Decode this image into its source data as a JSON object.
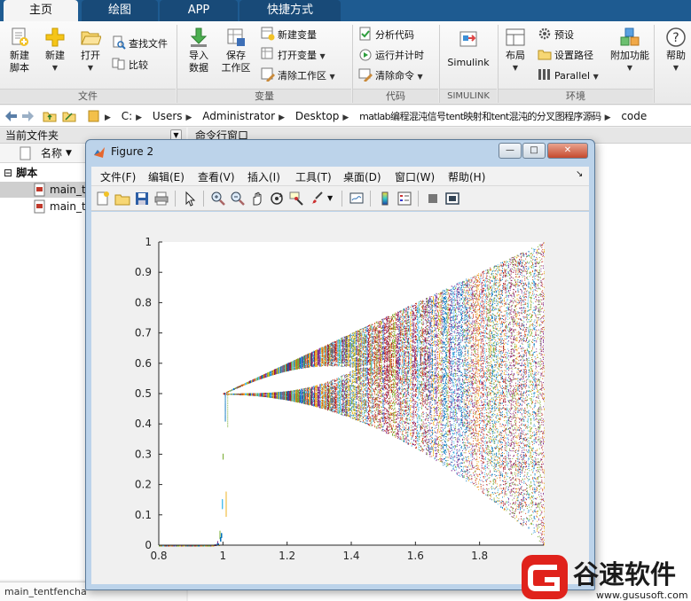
{
  "tabs": [
    {
      "label": "主页",
      "active": true
    },
    {
      "label": "绘图"
    },
    {
      "label": "APP"
    },
    {
      "label": "快捷方式"
    }
  ],
  "ribbon": {
    "file": {
      "new_script": "新建\n脚本",
      "new": "新建",
      "open": "打开",
      "find_files": "查找文件",
      "compare": "比较",
      "group": "文件"
    },
    "variable": {
      "import_data": "导入\n数据",
      "save_workspace": "保存\n工作区",
      "new_variable": "新建变量",
      "open_variable": "打开变量",
      "clear_workspace": "清除工作区",
      "group": "变量"
    },
    "code": {
      "analyze_code": "分析代码",
      "run_and_time": "运行并计时",
      "clear_commands": "清除命令",
      "group": "代码"
    },
    "simulink": {
      "label": "Simulink",
      "group": "SIMULINK"
    },
    "environment": {
      "layout": "布局",
      "preferences": "预设",
      "set_path": "设置路径",
      "parallel": "Parallel",
      "addons": "附加功能",
      "group": "环境"
    },
    "help": "帮助"
  },
  "address": {
    "crumbs": [
      "C:",
      "Users",
      "Administrator",
      "Desktop",
      "matlab编程混沌信号tent映射和tent混沌的分叉图程序源码",
      "code"
    ]
  },
  "left_panel": {
    "title": "当前文件夹",
    "col_name": "名称",
    "folder": "脚本",
    "files": [
      "main_te",
      "main_te"
    ],
    "status": "main_tentfencha"
  },
  "command_window": {
    "title": "命令行窗口"
  },
  "figure": {
    "title": "Figure 2",
    "menus": [
      "文件(F)",
      "编辑(E)",
      "查看(V)",
      "插入(I)",
      "工具(T)",
      "桌面(D)",
      "窗口(W)",
      "帮助(H)"
    ],
    "window_buttons": {
      "minimize": "—",
      "maximize": "□",
      "close": "✕"
    }
  },
  "chart_data": {
    "type": "scatter",
    "title": "",
    "xlabel": "",
    "ylabel": "",
    "xlim": [
      0.8,
      2.0
    ],
    "ylim": [
      0,
      1
    ],
    "xticks": [
      0.8,
      1,
      1.2,
      1.4,
      1.6,
      1.8
    ],
    "yticks": [
      0,
      0.1,
      0.2,
      0.3,
      0.4,
      0.5,
      0.6,
      0.7,
      0.8,
      0.9,
      1
    ],
    "grid": false,
    "series": [
      {
        "x": [
          0.85,
          0.9,
          0.95,
          0.98,
          1.0,
          1.0,
          1.0,
          1.0,
          1.05,
          1.1,
          1.2,
          1.3,
          1.35,
          1.4,
          1.42,
          1.5,
          1.6,
          1.7,
          1.8,
          1.9,
          2.0
        ],
        "y": [
          0,
          0,
          0,
          0.02,
          0.05,
          0.3,
          0.45,
          0.5,
          0.52,
          0.55,
          0.6,
          0.65,
          0.64,
          0.7,
          0.66,
          0.75,
          0.8,
          0.85,
          0.9,
          0.95,
          1.0
        ]
      }
    ],
    "palette": [
      "#0072bd",
      "#d95319",
      "#edb120",
      "#7e2f8e",
      "#77ac30",
      "#4dbeee",
      "#a2142f"
    ]
  },
  "watermark": {
    "brand": "谷速软件",
    "url": "www.gususoft.com"
  }
}
